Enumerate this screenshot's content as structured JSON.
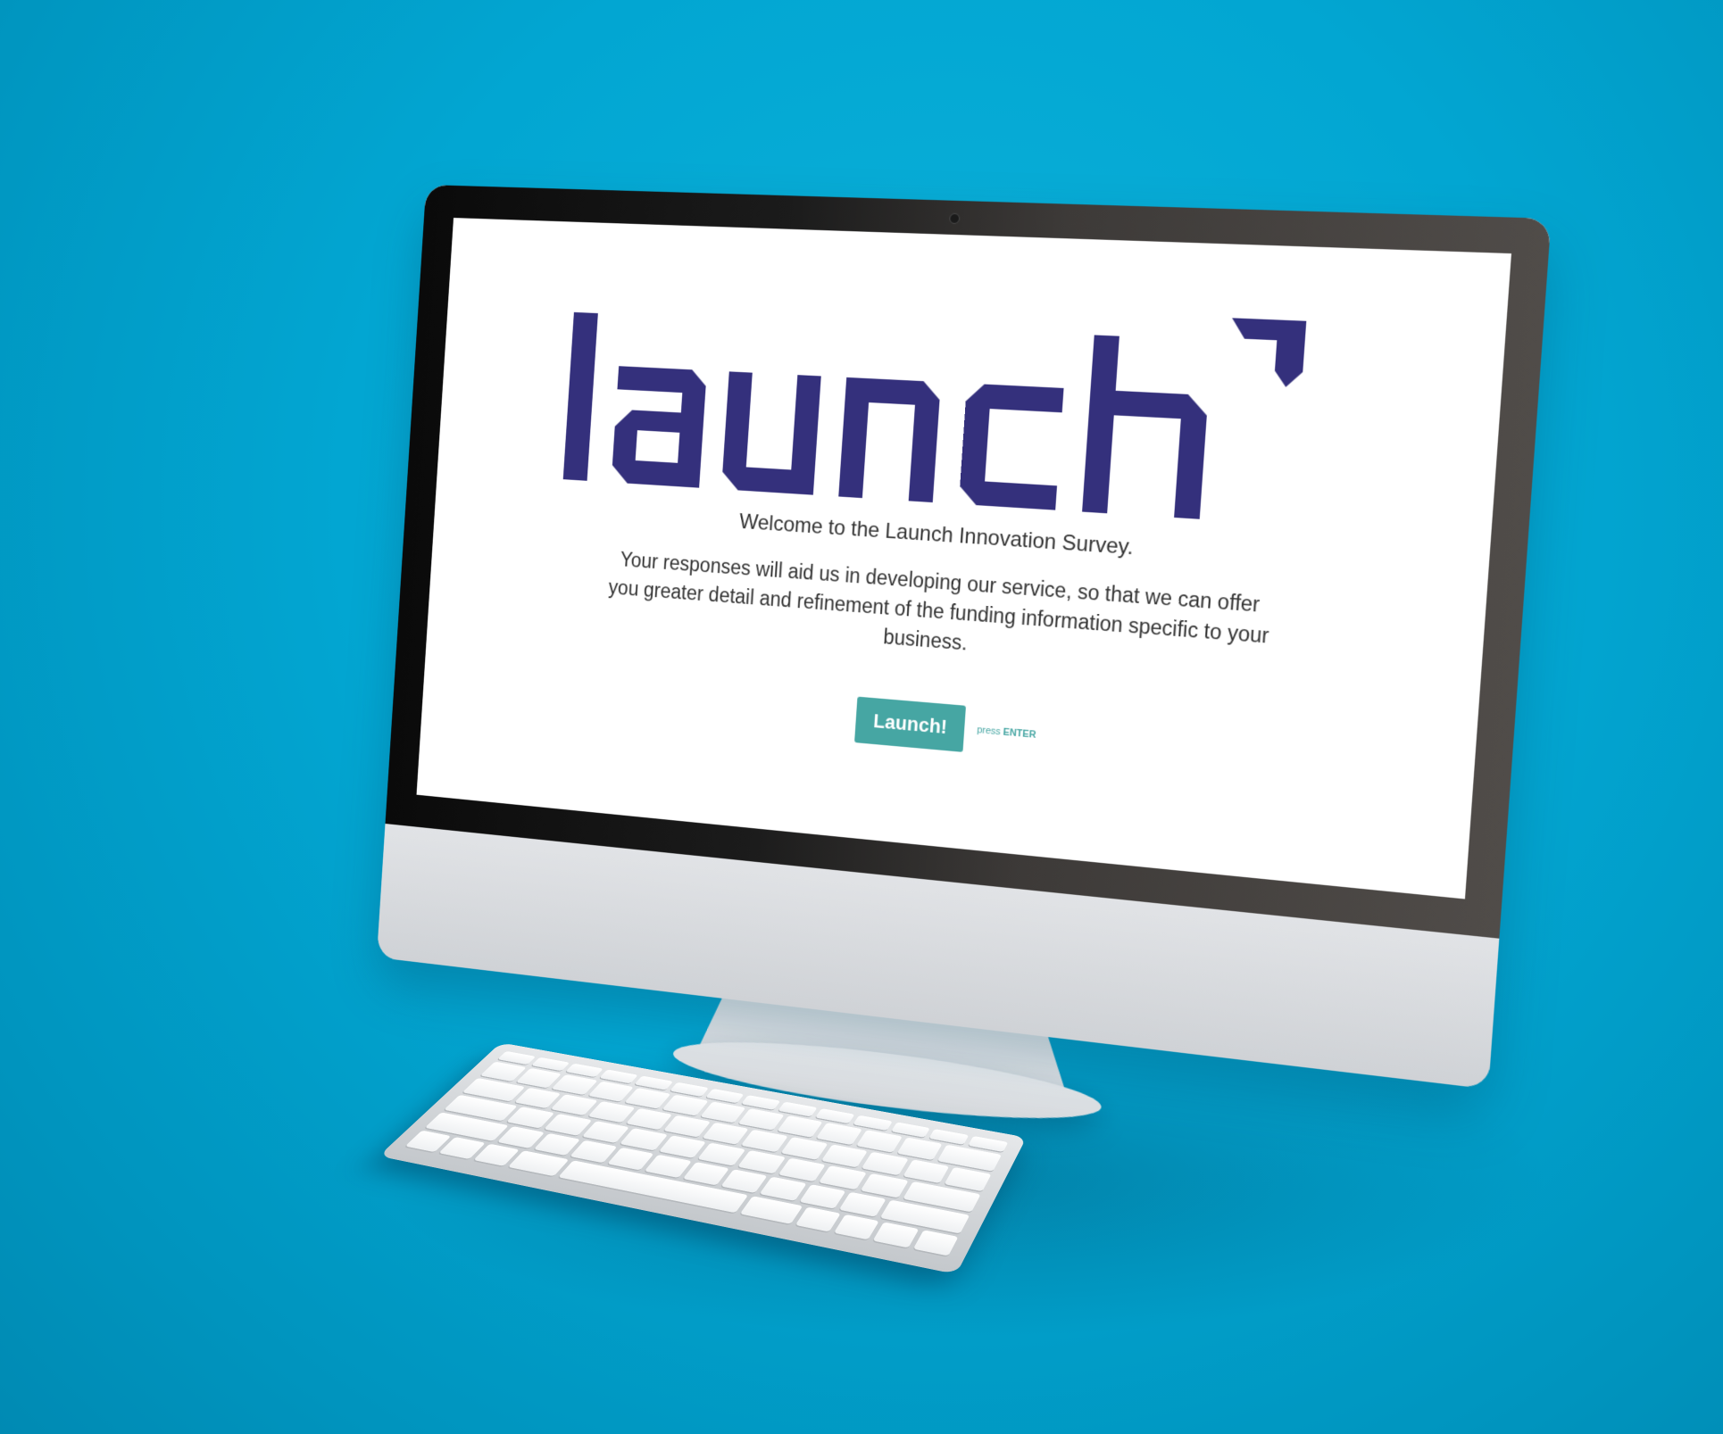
{
  "background": {
    "color": "#02a6d2"
  },
  "brand": {
    "color": "#34307c",
    "accent": "#46a6a3"
  },
  "logo": {
    "text": "launch",
    "icon": "arrow-corner-icon"
  },
  "survey": {
    "welcome": "Welcome to the Launch Innovation Survey.",
    "description": "Your responses will aid us in developing our service, so that we can offer you greater detail and refinement of the funding information specific to your business."
  },
  "cta": {
    "button_label": "Launch!",
    "hint_prefix": "press",
    "hint_key": "ENTER"
  }
}
